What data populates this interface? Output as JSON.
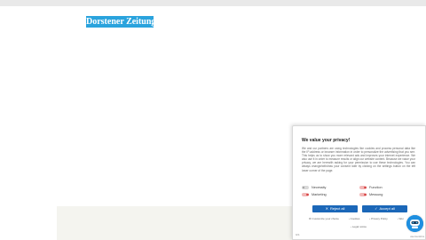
{
  "header": {
    "logo_text": "Dorstener Zeitung"
  },
  "consent": {
    "title": "We value your privacy!",
    "body": "We and our partners are using technologies like cookies and process personal data like the IP-address or browser information in order to personalize the advertising that you see. This helps us to show you more relevant ads and improves your internet experience. We also use it in order to measure results or align our website content. Because we value your privacy, we are herewith asking for your permission to use these technologies. You can always change/withdraw your consent later by clicking on the settings button on the left lower corner of the page.",
    "toggles": [
      {
        "label": "Necessity",
        "checked": false
      },
      {
        "label": "Function",
        "checked": true
      },
      {
        "label": "Marketing",
        "checked": true
      },
      {
        "label": "Messung",
        "checked": true
      }
    ],
    "buttons": {
      "reject_label": "Reject all",
      "accept_label": "Accept all"
    },
    "links": {
      "customize": "Customize your choice",
      "cookies": "Cookies",
      "privacy_policy": "Privacy Policy",
      "more": "Wei",
      "legal_notice": "Legal notice"
    },
    "corner_left": "GS",
    "corner_right": "usercentrics"
  },
  "colors": {
    "brand": "#2aa3dd",
    "button": "#1b67b8",
    "chat": "#1e8fe0"
  },
  "icons": {
    "reject": "close-icon",
    "accept": "check-icon",
    "chat": "chat-bot-icon"
  }
}
